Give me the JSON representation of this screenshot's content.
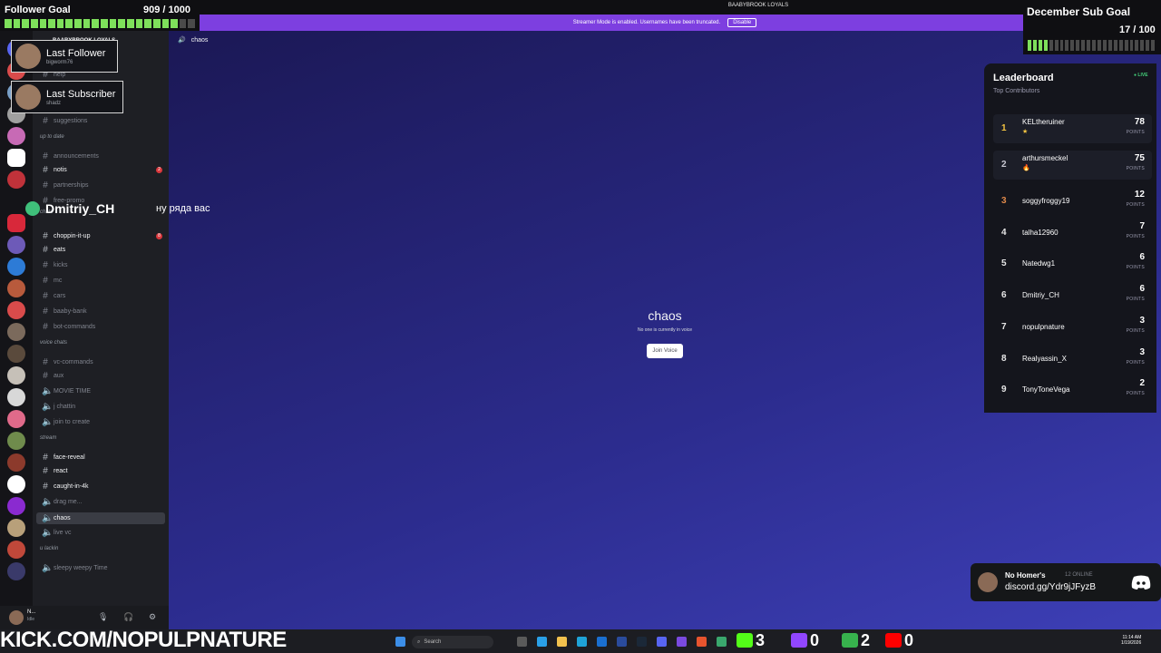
{
  "window": {
    "server_title": "BAABYBROOK LOYALS"
  },
  "streamer_banner": {
    "text": "Streamer Mode is enabled. Usernames have been truncated.",
    "button": "Disable"
  },
  "header": {
    "channel": "chaos"
  },
  "follower_goal": {
    "title": "Follower Goal",
    "count": "909 / 1000",
    "progress": 0.909
  },
  "sub_goal": {
    "title": "December Sub Goal",
    "count": "17 / 100",
    "progress": 0.17
  },
  "last_follower": {
    "title": "Last Follower",
    "name": "bigworm76"
  },
  "last_subscriber": {
    "title": "Last Subscriber",
    "name": "shadz"
  },
  "chat_overlay": {
    "name": "Dmitriy_CH",
    "message": "ну ряда вас"
  },
  "sidebar": {
    "server_name": "BAABYBROOK LOYALS",
    "items": [
      {
        "label": "verify",
        "type": "text",
        "state": "muted"
      },
      {
        "label": "help",
        "type": "text",
        "state": "muted"
      },
      {
        "label": "suggestions",
        "type": "text",
        "state": "muted"
      },
      {
        "label": "up to date",
        "type": "category"
      },
      {
        "label": "announcements",
        "type": "text",
        "state": "muted"
      },
      {
        "label": "notis",
        "type": "text",
        "state": "unread",
        "badge": "2"
      },
      {
        "label": "partnerships",
        "type": "text",
        "state": "muted"
      },
      {
        "label": "free-promo",
        "type": "text",
        "state": "muted"
      },
      {
        "label": "chats",
        "type": "category"
      },
      {
        "label": "choppin-it-up",
        "type": "text",
        "state": "unread",
        "badge": "8"
      },
      {
        "label": "eats",
        "type": "text",
        "state": "unread"
      },
      {
        "label": "kicks",
        "type": "text",
        "state": "muted"
      },
      {
        "label": "mc",
        "type": "text",
        "state": "muted"
      },
      {
        "label": "cars",
        "type": "text",
        "state": "muted"
      },
      {
        "label": "baaby-bank",
        "type": "text",
        "state": "muted"
      },
      {
        "label": "bot-commands",
        "type": "text",
        "state": "muted"
      },
      {
        "label": "voice chats",
        "type": "category"
      },
      {
        "label": "vc-commands",
        "type": "text",
        "state": "muted"
      },
      {
        "label": "aux",
        "type": "text",
        "state": "muted"
      },
      {
        "label": "MOVIE TIME",
        "type": "voice",
        "state": "muted"
      },
      {
        "label": "j chattin",
        "type": "voice",
        "state": "muted"
      },
      {
        "label": "join to create",
        "type": "voice",
        "state": "muted"
      },
      {
        "label": "stream",
        "type": "category"
      },
      {
        "label": "face-reveal",
        "type": "text",
        "state": "unread"
      },
      {
        "label": "react",
        "type": "text",
        "state": "unread"
      },
      {
        "label": "caught-in-4k",
        "type": "text",
        "state": "unread"
      },
      {
        "label": "drag me...",
        "type": "voice",
        "state": "muted"
      },
      {
        "label": "chaos",
        "type": "voice",
        "state": "selected"
      },
      {
        "label": "live vc",
        "type": "voice",
        "state": "muted"
      },
      {
        "label": "u lackin",
        "type": "category"
      },
      {
        "label": "sleepy weepy Time",
        "type": "voice",
        "state": "muted"
      }
    ]
  },
  "voice_panel": {
    "title": "chaos",
    "subtitle": "No one is currently in voice",
    "button": "Join Voice"
  },
  "leaderboard": {
    "title": "Leaderboard",
    "subtitle": "Top Contributors",
    "live": "LIVE",
    "points_label": "POINTS",
    "rows": [
      {
        "rank": "1",
        "name": "KELtheruiner",
        "points": "78",
        "icon": "★"
      },
      {
        "rank": "2",
        "name": "arthursmeckel",
        "points": "75",
        "icon": "🔥"
      },
      {
        "rank": "3",
        "name": "soggyfroggy19",
        "points": "12"
      },
      {
        "rank": "4",
        "name": "talha12960",
        "points": "7"
      },
      {
        "rank": "5",
        "name": "Natedwg1",
        "points": "6"
      },
      {
        "rank": "6",
        "name": "Dmitriy_CH",
        "points": "6"
      },
      {
        "rank": "7",
        "name": "nopulpnature",
        "points": "3"
      },
      {
        "rank": "8",
        "name": "Realyassin_X",
        "points": "3"
      },
      {
        "rank": "9",
        "name": "TonyToneVega",
        "points": "2"
      }
    ]
  },
  "discord_invite": {
    "title": "No Homer's",
    "online": "12 ONLINE",
    "link": "discord.gg/Ydr9jJFyzB"
  },
  "kick_banner": {
    "text": "KICK.COM/NOPULPNATURE"
  },
  "taskbar": {
    "search": "Search",
    "stats": [
      "3",
      "0",
      "2",
      "0"
    ],
    "time": "11:14 AM",
    "date": "1/19/2026"
  },
  "user_panel": {
    "name": "N...",
    "status": "Idle"
  },
  "colors": {
    "streamer_banner": "#7d3fe0",
    "goal_green": "#7ee05b",
    "main_bg_top": "#1b1855",
    "main_bg_bottom": "#3d3fb6"
  }
}
